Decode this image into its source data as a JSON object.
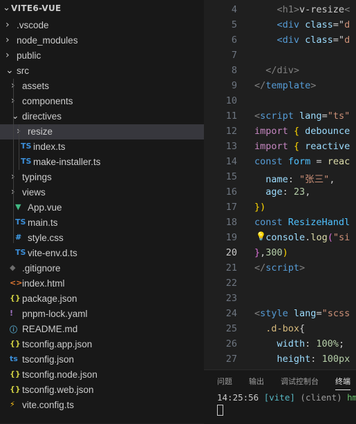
{
  "explorer": {
    "root": "VITE6-VUE",
    "items": [
      {
        "label": ".vscode",
        "type": "folder",
        "icon": "chevron-right-icon"
      },
      {
        "label": "node_modules",
        "type": "folder",
        "icon": "chevron-right-icon"
      },
      {
        "label": "public",
        "type": "folder",
        "icon": "chevron-right-icon"
      },
      {
        "label": "src",
        "type": "folder-open",
        "icon": "chevron-down-icon"
      },
      {
        "label": "assets",
        "type": "folder",
        "icon": "chevron-right-icon"
      },
      {
        "label": "components",
        "type": "folder",
        "icon": "chevron-right-icon"
      },
      {
        "label": "directives",
        "type": "folder-open",
        "icon": "chevron-down-icon"
      },
      {
        "label": "resize",
        "type": "folder",
        "icon": "chevron-right-icon"
      },
      {
        "label": "index.ts",
        "type": "file",
        "icon": "typescript-icon",
        "glyph": "TS",
        "color": "#3b8ed8"
      },
      {
        "label": "make-installer.ts",
        "type": "file",
        "icon": "typescript-icon",
        "glyph": "TS",
        "color": "#3b8ed8"
      },
      {
        "label": "typings",
        "type": "folder",
        "icon": "chevron-right-icon"
      },
      {
        "label": "views",
        "type": "folder",
        "icon": "chevron-right-icon"
      },
      {
        "label": "App.vue",
        "type": "file",
        "icon": "vue-icon",
        "glyph": "▼",
        "color": "#41b883"
      },
      {
        "label": "main.ts",
        "type": "file",
        "icon": "typescript-icon",
        "glyph": "TS",
        "color": "#3b8ed8"
      },
      {
        "label": "style.css",
        "type": "file",
        "icon": "css-icon",
        "glyph": "#",
        "color": "#42a5f5"
      },
      {
        "label": "vite-env.d.ts",
        "type": "file",
        "icon": "typescript-icon",
        "glyph": "TS",
        "color": "#3b8ed8"
      },
      {
        "label": ".gitignore",
        "type": "file",
        "icon": "git-icon",
        "glyph": "◆",
        "color": "#6d6d6d"
      },
      {
        "label": "index.html",
        "type": "file",
        "icon": "html-icon",
        "glyph": "<>",
        "color": "#e37933"
      },
      {
        "label": "package.json",
        "type": "file",
        "icon": "json-icon",
        "glyph": "{}",
        "color": "#cbcb41"
      },
      {
        "label": "pnpm-lock.yaml",
        "type": "file",
        "icon": "yaml-icon",
        "glyph": "!",
        "color": "#a074c4"
      },
      {
        "label": "README.md",
        "type": "file",
        "icon": "info-icon",
        "glyph": "ⓘ",
        "color": "#519aba"
      },
      {
        "label": "tsconfig.app.json",
        "type": "file",
        "icon": "json-icon",
        "glyph": "{}",
        "color": "#cbcb41"
      },
      {
        "label": "tsconfig.json",
        "type": "file",
        "icon": "tsconfig-icon",
        "glyph": "ts",
        "color": "#3b8ed8"
      },
      {
        "label": "tsconfig.node.json",
        "type": "file",
        "icon": "json-icon",
        "glyph": "{}",
        "color": "#cbcb41"
      },
      {
        "label": "tsconfig.web.json",
        "type": "file",
        "icon": "json-icon",
        "glyph": "{}",
        "color": "#cbcb41"
      },
      {
        "label": "vite.config.ts",
        "type": "file",
        "icon": "vite-icon",
        "glyph": "⚡",
        "color": "#ffc517"
      }
    ]
  },
  "editor": {
    "active_line": "20",
    "lines": [
      {
        "n": "4",
        "t": [
          [
            "    ",
            "#cccccc"
          ],
          [
            "<h1>",
            "#808080"
          ],
          [
            "v-resize",
            "#cccccc"
          ],
          [
            "<",
            "#808080"
          ]
        ]
      },
      {
        "n": "5",
        "t": [
          [
            "    ",
            "#cccccc"
          ],
          [
            "<div ",
            "#569cd6"
          ],
          [
            "class",
            "#9cdcfe"
          ],
          [
            "=\"",
            "#cccccc"
          ],
          [
            "d",
            "#ce9178"
          ]
        ]
      },
      {
        "n": "6",
        "t": [
          [
            "    ",
            "#cccccc"
          ],
          [
            "<div ",
            "#569cd6"
          ],
          [
            "class",
            "#9cdcfe"
          ],
          [
            "=\"",
            "#cccccc"
          ],
          [
            "d",
            "#ce9178"
          ]
        ]
      },
      {
        "n": "7",
        "t": []
      },
      {
        "n": "8",
        "t": [
          [
            "  ",
            "#cccccc"
          ],
          [
            "</div>",
            "#808080"
          ]
        ]
      },
      {
        "n": "9",
        "t": [
          [
            "</",
            "#808080"
          ],
          [
            "template",
            "#569cd6"
          ],
          [
            ">",
            "#808080"
          ]
        ]
      },
      {
        "n": "10",
        "t": []
      },
      {
        "n": "11",
        "t": [
          [
            "<",
            "#808080"
          ],
          [
            "script ",
            "#569cd6"
          ],
          [
            "lang",
            "#9cdcfe"
          ],
          [
            "=",
            "#cccccc"
          ],
          [
            "\"ts\"",
            "#ce9178"
          ]
        ]
      },
      {
        "n": "12",
        "t": [
          [
            "import ",
            "#c586c0"
          ],
          [
            "{ ",
            "#ffd700"
          ],
          [
            "debounce",
            "#9cdcfe"
          ]
        ]
      },
      {
        "n": "13",
        "t": [
          [
            "import ",
            "#c586c0"
          ],
          [
            "{ ",
            "#ffd700"
          ],
          [
            "reactive",
            "#9cdcfe"
          ]
        ]
      },
      {
        "n": "14",
        "t": [
          [
            "const ",
            "#569cd6"
          ],
          [
            "form",
            "#4fc1ff"
          ],
          [
            " = ",
            "#cccccc"
          ],
          [
            "reac",
            "#dcdcaa"
          ]
        ]
      },
      {
        "n": "15",
        "t": [
          [
            "  ",
            "#cccccc"
          ],
          [
            "name",
            "#9cdcfe"
          ],
          [
            ": ",
            "#cccccc"
          ],
          [
            "\"张三\"",
            "#ce9178"
          ],
          [
            ",",
            "#cccccc"
          ]
        ]
      },
      {
        "n": "16",
        "t": [
          [
            "  ",
            "#cccccc"
          ],
          [
            "age",
            "#9cdcfe"
          ],
          [
            ": ",
            "#cccccc"
          ],
          [
            "23",
            "#b5cea8"
          ],
          [
            ",",
            "#cccccc"
          ]
        ]
      },
      {
        "n": "17",
        "t": [
          [
            "})",
            "#ffd700"
          ]
        ]
      },
      {
        "n": "18",
        "t": [
          [
            "const ",
            "#569cd6"
          ],
          [
            "ResizeHandl",
            "#4fc1ff"
          ]
        ]
      },
      {
        "n": "19",
        "t": [
          [
            "  ",
            "#cccccc"
          ],
          [
            "console",
            "#9cdcfe"
          ],
          [
            ".",
            "#cccccc"
          ],
          [
            "log",
            "#dcdcaa"
          ],
          [
            "(",
            "#da70d6"
          ],
          [
            "\"si",
            "#ce9178"
          ]
        ]
      },
      {
        "n": "20",
        "t": [
          [
            "}",
            "#da70d6"
          ],
          [
            ",",
            "#cccccc"
          ],
          [
            "300",
            "#b5cea8"
          ],
          [
            ")",
            "#ffd700"
          ]
        ]
      },
      {
        "n": "21",
        "t": [
          [
            "</",
            "#808080"
          ],
          [
            "script",
            "#569cd6"
          ],
          [
            ">",
            "#808080"
          ]
        ]
      },
      {
        "n": "22",
        "t": []
      },
      {
        "n": "23",
        "t": []
      },
      {
        "n": "24",
        "t": [
          [
            "<",
            "#808080"
          ],
          [
            "style ",
            "#569cd6"
          ],
          [
            "lang",
            "#9cdcfe"
          ],
          [
            "=",
            "#cccccc"
          ],
          [
            "\"scss",
            "#ce9178"
          ]
        ]
      },
      {
        "n": "25",
        "t": [
          [
            "  ",
            "#cccccc"
          ],
          [
            ".d-box",
            "#d7ba7d"
          ],
          [
            "{",
            "#cccccc"
          ]
        ]
      },
      {
        "n": "26",
        "t": [
          [
            "    ",
            "#cccccc"
          ],
          [
            "width",
            "#9cdcfe"
          ],
          [
            ": ",
            "#cccccc"
          ],
          [
            "100%",
            "#b5cea8"
          ],
          [
            ";",
            "#cccccc"
          ]
        ]
      },
      {
        "n": "27",
        "t": [
          [
            "    ",
            "#cccccc"
          ],
          [
            "height",
            "#9cdcfe"
          ],
          [
            ": ",
            "#cccccc"
          ],
          [
            "100px",
            "#b5cea8"
          ]
        ]
      }
    ]
  },
  "panel": {
    "tabs": [
      "问题",
      "输出",
      "调试控制台",
      "终端"
    ],
    "active_tab": "终端",
    "terminal": [
      {
        "text": "14:25:56 ",
        "color": "#cccccc"
      },
      {
        "text": "[vite]",
        "color": "#56b6c2"
      },
      {
        "text": " (client) ",
        "color": "#9d9d9d"
      },
      {
        "text": "hmr",
        "color": "#6bc46d"
      }
    ]
  }
}
